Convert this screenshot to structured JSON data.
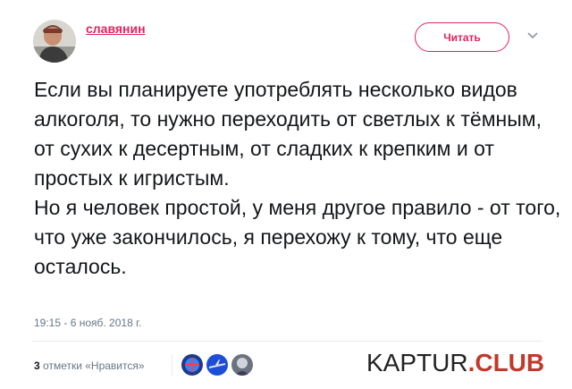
{
  "author": {
    "name": "славянин"
  },
  "follow_button": {
    "label": "Читать"
  },
  "tweet": {
    "text": "Если вы планируете употреблять несколько видов алкоголя, то нужно переходить от светлых к тёмным, от сухих к десертным, от сладких к крепким и от простых к игристым.\nНо я человек простой, у меня другое правило - от того, что уже закончилось, я перехожу к тому, что еще осталось.",
    "timestamp": "19:15 - 6 нояб. 2018 г."
  },
  "likes": {
    "count": "3",
    "label": "отметки «Нравится»"
  },
  "watermark": {
    "part1": "KAPTUR",
    "part2": ".CLUB"
  },
  "colors": {
    "accent": "#e0245e",
    "text": "#14171a",
    "muted": "#657786"
  }
}
